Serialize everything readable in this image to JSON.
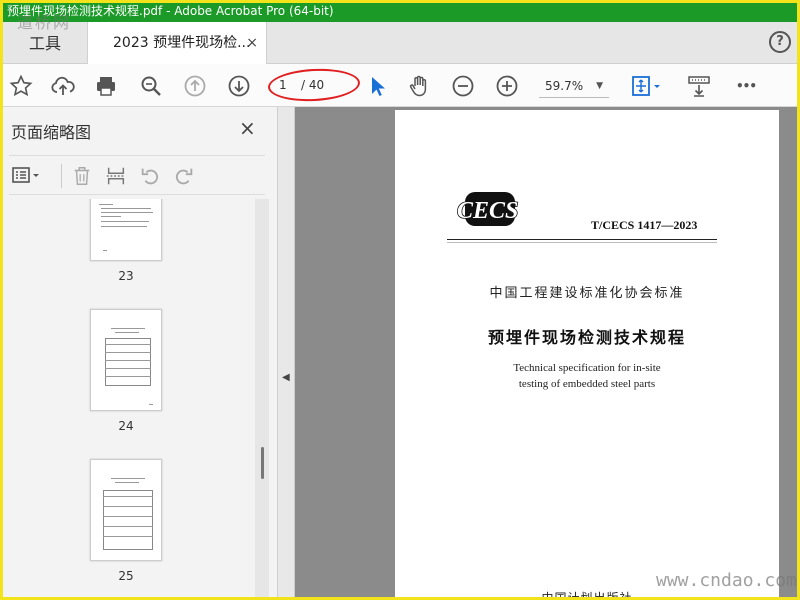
{
  "window": {
    "title": "预埋件现场检测技术规程.pdf - Adobe Acrobat Pro (64-bit)",
    "watermark_top": "道桥网",
    "watermark_bottom": "www.cndao.com"
  },
  "tabs": {
    "tools_label": "工具",
    "doc_tab_label": "2023 预埋件现场检...",
    "close_glyph": "×",
    "help_glyph": "?"
  },
  "toolbar": {
    "current_page": "1",
    "total_pages": "/ 40",
    "zoom": "59.7%",
    "more_glyph": "•••"
  },
  "left_panel": {
    "title": "页面缩略图",
    "close_glyph": "×",
    "thumbnails": [
      {
        "label": "23"
      },
      {
        "label": "24"
      },
      {
        "label": "25"
      }
    ]
  },
  "document": {
    "logo_text": "CECS",
    "standard_code": "T/CECS 1417—2023",
    "association": "中国工程建设标准化协会标准",
    "title_cn": "预埋件现场检测技术规程",
    "title_en_line1": "Technical specification for in-site",
    "title_en_line2": "testing of embedded steel parts",
    "publisher": "中国计划出版社"
  },
  "colors": {
    "title_bar": "#1b9a28",
    "frame": "#f2e31a",
    "annotation_oval": "#e02020",
    "select_tool": "#1a6fd6"
  }
}
